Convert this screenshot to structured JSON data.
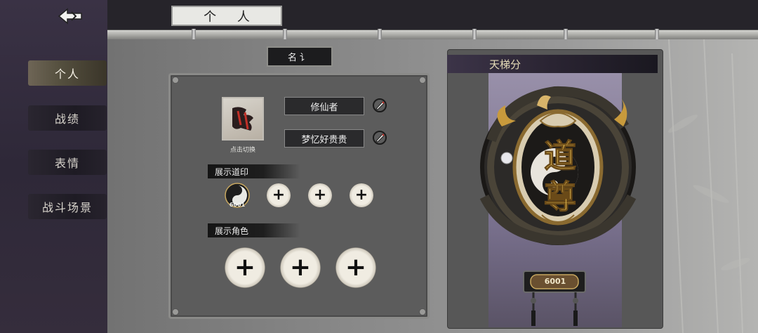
{
  "header": {
    "title": "个 人"
  },
  "sidebar": {
    "items": [
      {
        "label": "个人",
        "active": true
      },
      {
        "label": "战绩",
        "active": false
      },
      {
        "label": "表情",
        "active": false
      },
      {
        "label": "战斗场景",
        "active": false
      }
    ]
  },
  "profile": {
    "title_tag": "名讠",
    "avatar_caption": "点击切换",
    "title_field": "修仙者",
    "nickname_field": "梦忆好贵贵"
  },
  "sections": {
    "seals_label": "展示道印",
    "roles_label": "展示角色"
  },
  "seal": {
    "id": "6001"
  },
  "ladder": {
    "header": "天梯分",
    "rank_glyph": "道尊",
    "score": "6001"
  },
  "colors": {
    "accent_gold": "#d8b46a",
    "panel": "#5c5c5c",
    "sidebar": "#2e2838"
  }
}
